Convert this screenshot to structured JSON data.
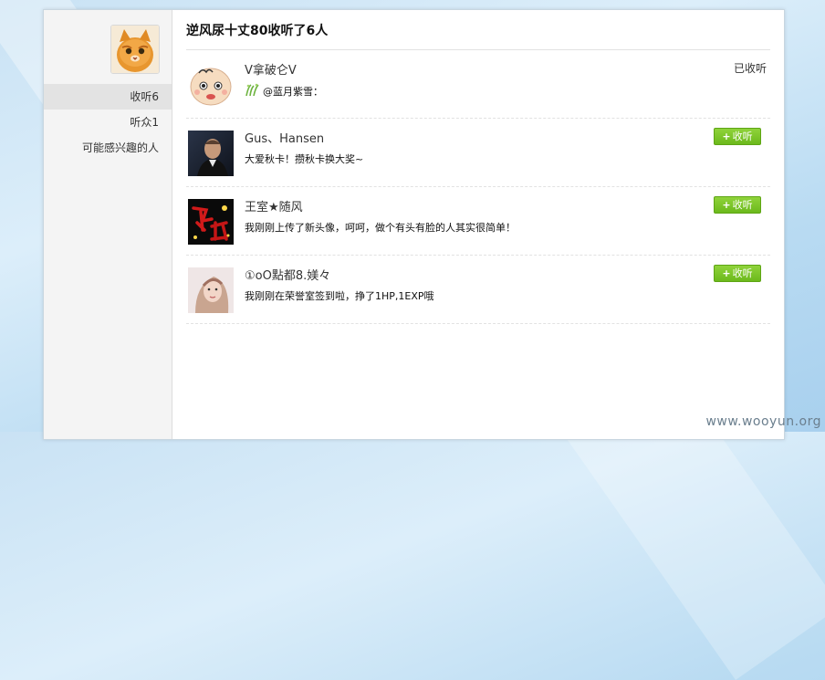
{
  "page": {
    "title": "逆风尿十丈80收听了6人"
  },
  "sidebar": {
    "items": [
      {
        "label": "收听6",
        "active": true
      },
      {
        "label": "听众1",
        "active": false
      },
      {
        "label": "可能感兴趣的人",
        "active": false
      }
    ]
  },
  "list": {
    "rows": [
      {
        "name": "V拿破仑V",
        "status": "@蓝月紫雪：",
        "action": "已收听",
        "followed": true,
        "avatar": "baby-cartoon"
      },
      {
        "name": "Gus、Hansen",
        "status": "大爱秋卡！攒秋卡换大奖~",
        "action": "收听",
        "followed": false,
        "avatar": "man-portrait"
      },
      {
        "name": "王室★随风",
        "status": "我刚刚上传了新头像，呵呵，做个有头有脸的人其实很简单！",
        "action": "收听",
        "followed": false,
        "avatar": "red-calligraphy"
      },
      {
        "name": "①oO點都8.媄々",
        "status": "我刚刚在荣誉室签到啦，挣了1HP,1EXP哦",
        "action": "收听",
        "followed": false,
        "avatar": "woman-portrait"
      }
    ]
  },
  "watermark": "www.wooyun.org",
  "colors": {
    "follow_button": "#7dc72a",
    "sidebar_bg": "#f4f4f4",
    "sidebar_active": "#e3e3e3"
  }
}
